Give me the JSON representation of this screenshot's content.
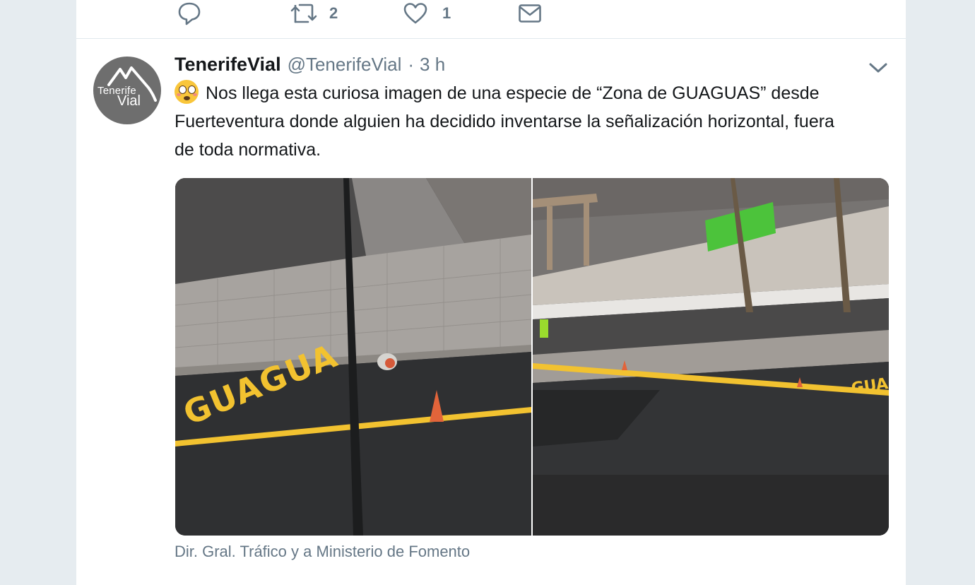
{
  "previous_tweet": {
    "retweet_count": "2",
    "like_count": "1"
  },
  "tweet": {
    "avatar_text_line1": "Tenerife",
    "avatar_text_line2": "Vial",
    "name": "TenerifeVial",
    "handle": "@TenerifeVial",
    "separator": "·",
    "time": "3 h",
    "text": "Nos llega esta curiosa imagen de una especie de “Zona de GUAGUAS” desde Fuerteventura donde alguien ha decidido inventarse la señalización horizontal, fuera de toda normativa.",
    "emoji": "flushed-face-emoji",
    "photo_left_road_text": "GUAGUA",
    "photo_right_road_text": "GUA",
    "tagged": "Dir. Gral. Tráfico y a Ministerio de Fomento"
  },
  "icons": {
    "reply": "reply-icon",
    "retweet": "retweet-icon",
    "like": "heart-icon",
    "message": "mail-icon",
    "more": "chevron-down-icon"
  },
  "colors": {
    "background": "#e6ecf0",
    "text_primary": "#14171a",
    "text_secondary": "#657786",
    "road_marking": "#f2c230"
  }
}
